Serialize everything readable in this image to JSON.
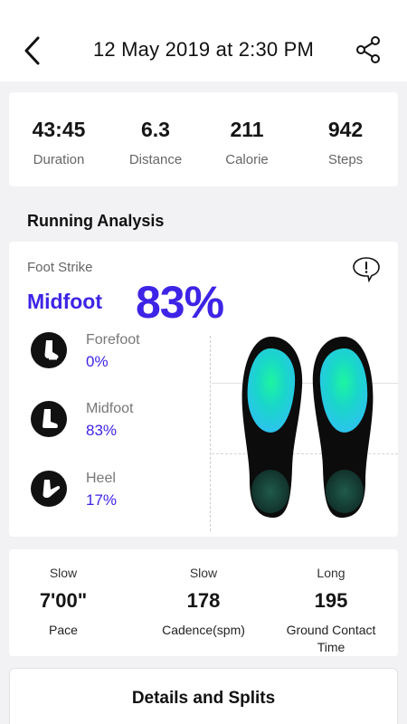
{
  "header": {
    "title": "12 May 2019  at 2:30 PM",
    "back_icon": "chevron-left-icon",
    "share_icon": "share-icon"
  },
  "summary": {
    "stats": [
      {
        "value": "43:45",
        "label": "Duration"
      },
      {
        "value": "6.3",
        "label": "Distance"
      },
      {
        "value": "211",
        "label": "Calorie"
      },
      {
        "value": "942",
        "label": "Steps"
      }
    ]
  },
  "analysis": {
    "section_title": "Running Analysis",
    "foot_strike_label": "Foot Strike",
    "foot_strike_type": "Midfoot",
    "foot_strike_percent": "83%",
    "info_icon": "info-bubble-icon",
    "strikes": [
      {
        "name": "Forefoot",
        "value": "0%",
        "icon": "forefoot-icon"
      },
      {
        "name": "Midfoot",
        "value": "83%",
        "icon": "midfoot-icon"
      },
      {
        "name": "Heel",
        "value": "17%",
        "icon": "heel-icon"
      }
    ],
    "accent_color": "#3d24e6"
  },
  "metrics": [
    {
      "sub": "Slow",
      "value": "7'00\"",
      "label": "Pace"
    },
    {
      "sub": "Slow",
      "value": "178",
      "label": "Cadence(spm)"
    },
    {
      "sub": "Long",
      "value": "195",
      "label": "Ground Contact Time"
    }
  ],
  "details": {
    "label": "Details and Splits"
  }
}
